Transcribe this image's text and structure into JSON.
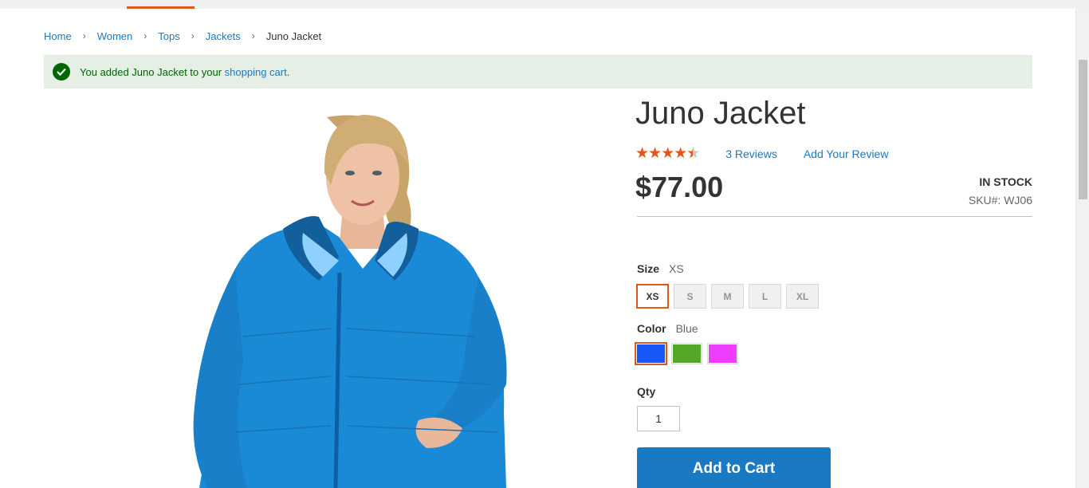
{
  "breadcrumb": {
    "items": [
      "Home",
      "Women",
      "Tops",
      "Jackets"
    ],
    "current": "Juno Jacket"
  },
  "message": {
    "prefix": "You added Juno Jacket to your ",
    "link": "shopping cart",
    "suffix": "."
  },
  "product": {
    "title": "Juno Jacket",
    "rating_stars": 4.5,
    "rating_max": 5,
    "reviews_label": "3  Reviews",
    "add_review_label": "Add Your Review",
    "price": "$77.00",
    "stock": "IN STOCK",
    "sku": "SKU#:   WJ06"
  },
  "options": {
    "size": {
      "label": "Size",
      "selected": "XS",
      "values": [
        "XS",
        "S",
        "M",
        "L",
        "XL"
      ]
    },
    "color": {
      "label": "Color",
      "selected": "Blue",
      "swatches": [
        {
          "name": "Blue",
          "hex": "#1857f7"
        },
        {
          "name": "Green",
          "hex": "#53a828"
        },
        {
          "name": "Purple",
          "hex": "#ef3dff"
        }
      ]
    }
  },
  "qty": {
    "label": "Qty",
    "value": "1"
  },
  "actions": {
    "add_to_cart": "Add to Cart"
  },
  "colors": {
    "accent": "#e0591a",
    "link": "#1979c3",
    "success_bg": "#e5efe5",
    "success_text": "#006400"
  }
}
